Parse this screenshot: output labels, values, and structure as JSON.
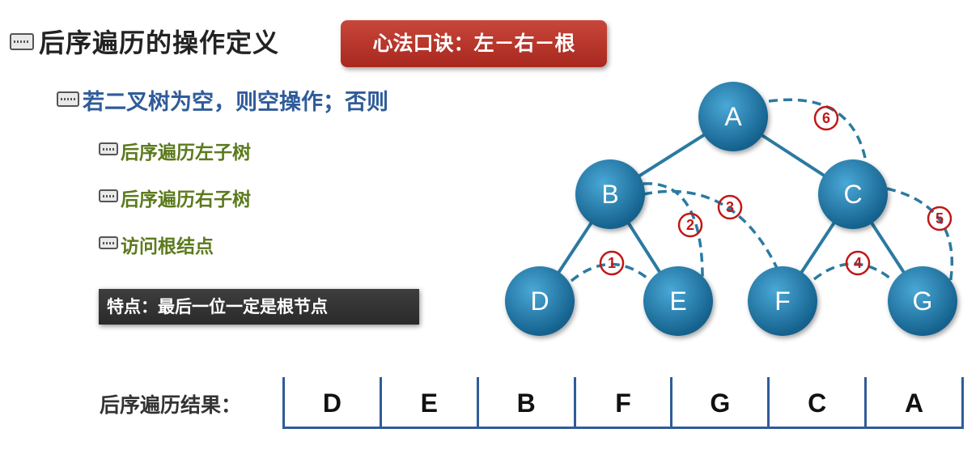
{
  "title": "后序遍历的操作定义",
  "mnemonic": "心法口诀：左－右－根",
  "rule_level1": "若二叉树为空，则空操作；否则",
  "rule_steps": [
    "后序遍历左子树",
    "后序遍历右子树",
    "访问根结点"
  ],
  "feature": "特点：最后一位一定是根节点",
  "result_label": "后序遍历结果：",
  "result_sequence": [
    "D",
    "E",
    "B",
    "F",
    "G",
    "C",
    "A"
  ],
  "tree": {
    "nodes": [
      "A",
      "B",
      "C",
      "D",
      "E",
      "F",
      "G"
    ],
    "edges": [
      [
        "A",
        "B"
      ],
      [
        "A",
        "C"
      ],
      [
        "B",
        "D"
      ],
      [
        "B",
        "E"
      ],
      [
        "C",
        "F"
      ],
      [
        "C",
        "G"
      ]
    ],
    "visit_order_labels": [
      "1",
      "2",
      "3",
      "4",
      "5",
      "6"
    ]
  },
  "colors": {
    "node_fill": "#1e77a8",
    "edge": "#2b7aa1",
    "order_mark": "#c01818",
    "mnemonic_bg": "#b8362b",
    "level1_text": "#2f5c99",
    "level2_text": "#5b7a1c",
    "result_border": "#2f5c99"
  }
}
